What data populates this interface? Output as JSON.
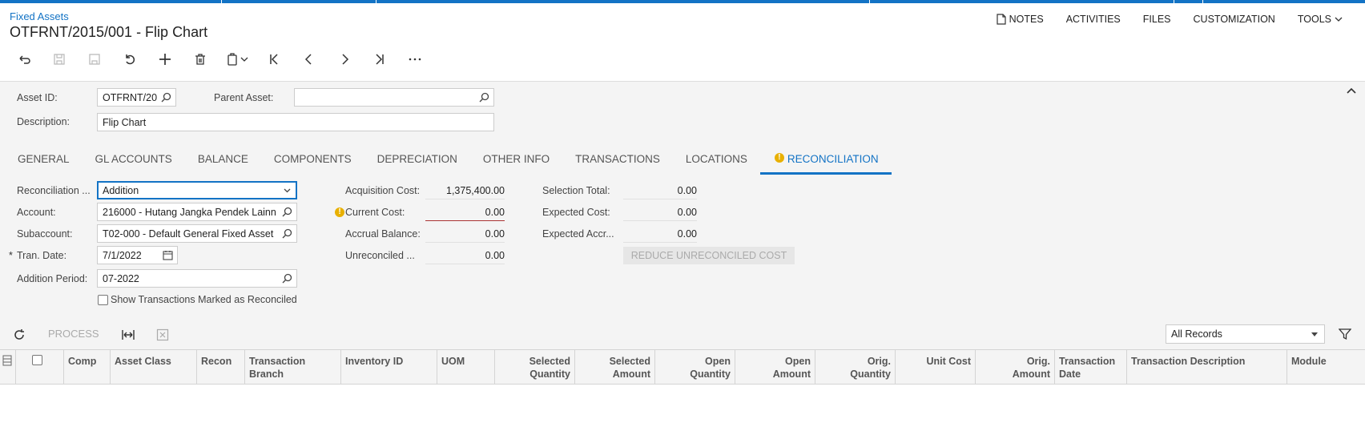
{
  "header": {
    "breadcrumb": "Fixed Assets",
    "title": "OTFRNT/2015/001 - Flip Chart",
    "links": [
      "NOTES",
      "ACTIVITIES",
      "FILES",
      "CUSTOMIZATION",
      "TOOLS"
    ]
  },
  "toolbar": {
    "buttons": [
      "undo-arrow",
      "save-close",
      "save",
      "cancel",
      "add",
      "delete",
      "copy-paste",
      "first",
      "previous",
      "next",
      "last",
      "more"
    ]
  },
  "form": {
    "asset_id_label": "Asset ID:",
    "asset_id_value": "OTFRNT/20",
    "parent_asset_label": "Parent Asset:",
    "parent_asset_value": "",
    "description_label": "Description:",
    "description_value": "Flip Chart"
  },
  "tabs": [
    {
      "label": "GENERAL"
    },
    {
      "label": "GL ACCOUNTS"
    },
    {
      "label": "BALANCE"
    },
    {
      "label": "COMPONENTS"
    },
    {
      "label": "DEPRECIATION"
    },
    {
      "label": "OTHER INFO"
    },
    {
      "label": "TRANSACTIONS"
    },
    {
      "label": "LOCATIONS"
    },
    {
      "label": "RECONCILIATION",
      "active": true
    }
  ],
  "reconciliation": {
    "type_label": "Reconciliation ...",
    "type_value": "Addition",
    "account_label": "Account:",
    "account_value": "216000 - Hutang Jangka Pendek Lainn",
    "subaccount_label": "Subaccount:",
    "subaccount_value": "T02-000 - Default General Fixed Asset",
    "tran_date_required": "*",
    "tran_date_label": "Tran. Date:",
    "tran_date_value": "7/1/2022",
    "addition_period_label": "Addition Period:",
    "addition_period_value": "07-2022",
    "show_reconciled_label": "Show Transactions Marked as Reconciled",
    "acquisition_cost_label": "Acquisition Cost:",
    "acquisition_cost_value": "1,375,400.00",
    "current_cost_label": "Current Cost:",
    "current_cost_value": "0.00",
    "accrual_balance_label": "Accrual Balance:",
    "accrual_balance_value": "0.00",
    "unreconciled_label": "Unreconciled ...",
    "unreconciled_value": "0.00",
    "selection_total_label": "Selection Total:",
    "selection_total_value": "0.00",
    "expected_cost_label": "Expected Cost:",
    "expected_cost_value": "0.00",
    "expected_accr_label": "Expected Accr...",
    "expected_accr_value": "0.00",
    "reduce_button": "REDUCE UNRECONCILED COST"
  },
  "grid": {
    "process_label": "PROCESS",
    "filter_value": "All Records",
    "columns": [
      {
        "l1": "Comp"
      },
      {
        "l1": "Asset Class"
      },
      {
        "l1": "Recon"
      },
      {
        "l1": "Transaction",
        "l2": "Branch"
      },
      {
        "l1": "Inventory ID"
      },
      {
        "l1": "UOM"
      },
      {
        "l1": "Selected",
        "l2": "Quantity"
      },
      {
        "l1": "Selected",
        "l2": "Amount"
      },
      {
        "l1": "Open",
        "l2": "Quantity"
      },
      {
        "l1": "Open",
        "l2": "Amount"
      },
      {
        "l1": "Orig.",
        "l2": "Quantity"
      },
      {
        "l1": "Unit Cost"
      },
      {
        "l1": "Orig.",
        "l2": "Amount"
      },
      {
        "l1": "Transaction",
        "l2": "Date"
      },
      {
        "l1": "Transaction Description"
      },
      {
        "l1": "Module"
      }
    ]
  },
  "warn_mark": "!",
  "colors": {
    "accent": "#1373c5",
    "warning": "#e8b000"
  }
}
